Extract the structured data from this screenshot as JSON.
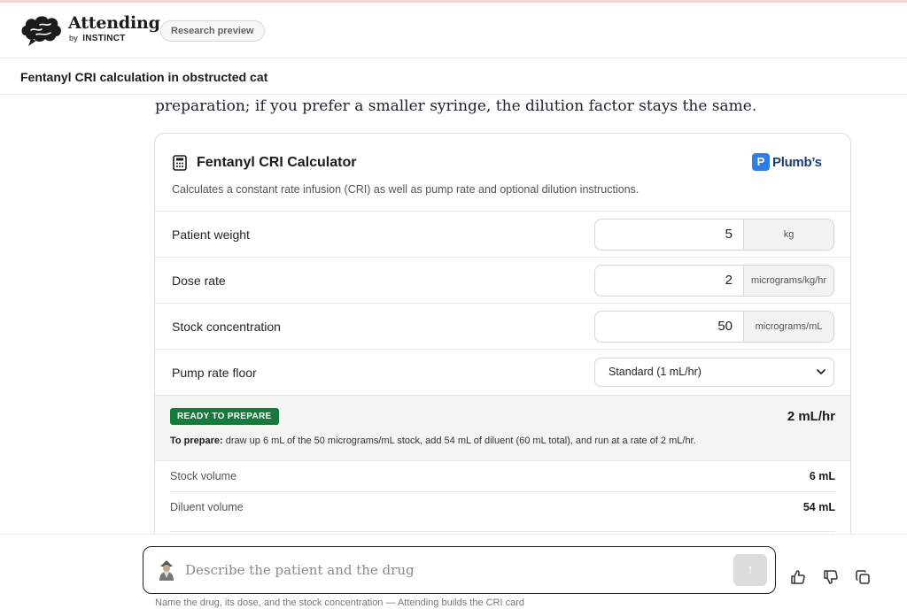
{
  "header": {
    "brand_name": "Attending",
    "brand_by": "by",
    "brand_company": "INSTINCT",
    "pill_label": "Research preview"
  },
  "conversation": {
    "title": "Fentanyl CRI calculation in obstructed cat"
  },
  "message": {
    "prose": "preparation; if you prefer a smaller syringe, the dilution factor stays the same."
  },
  "calculator": {
    "title": "Fentanyl CRI Calculator",
    "source_badge": "P",
    "source_name": "Plumb’s",
    "description": "Calculates a constant rate infusion (CRI) as well as pump rate and optional dilution instructions.",
    "fields": [
      {
        "label": "Patient weight",
        "value": "5",
        "unit": "kg"
      },
      {
        "label": "Dose rate",
        "value": "2",
        "unit": "micrograms/kg/hr"
      },
      {
        "label": "Stock concentration",
        "value": "50",
        "unit": "micrograms/mL"
      }
    ],
    "pump_floor": {
      "label": "Pump rate floor",
      "selected": "Standard (1 mL/hr)"
    },
    "result": {
      "status": "READY TO PREPARE",
      "rate": "2 mL/hr",
      "instructions_prefix": "To prepare:",
      "instructions": " draw up 6 mL of the 50 micrograms/mL stock, add 54 mL of diluent (60 mL total), and run at a rate of 2 mL/hr."
    },
    "details": [
      {
        "label": "Stock volume",
        "value": "6 mL"
      },
      {
        "label": "Diluent volume",
        "value": "54 mL"
      }
    ]
  },
  "composer": {
    "placeholder": "Describe the patient and the drug",
    "send_icon": "↑",
    "hint": "Name the drug, its dose, and the stock concentration — Attending builds the CRI card"
  },
  "colors": {
    "ready_green": "#167a3a",
    "plumbs_blue": "#2f7ee6"
  }
}
